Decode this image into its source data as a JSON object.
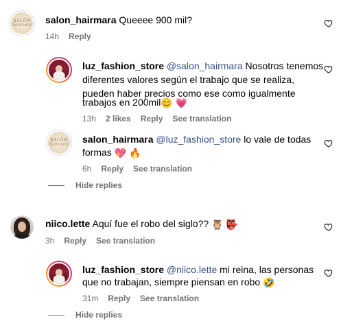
{
  "comments": [
    {
      "username": "salon_hairmara",
      "text": "Queeee 900 mil?",
      "time": "14h",
      "reply_label": "Reply",
      "avatar": "salon-hairmara-logo"
    }
  ],
  "replies_group_1": [
    {
      "username": "luz_fashion_store",
      "mention": "@salon_hairmara",
      "text_line1": " Nosotros tenemos",
      "text_line2": "diferentes valores según el trabajo que se realiza,",
      "text_line3": "pueden haber precios como ese como igualmente",
      "text_line4": "trabajos en 200mil",
      "emojis": [
        "😊",
        "💗"
      ],
      "time": "13h",
      "likes": "2 likes",
      "reply_label": "Reply",
      "translation_label": "See translation"
    },
    {
      "username": "salon_hairmara",
      "mention": "@luz_fashion_store",
      "text_line1": " lo vale de todas",
      "text_line2": "formas",
      "emojis": [
        "💖",
        "🔥"
      ],
      "time": "6h",
      "reply_label": "Reply",
      "translation_label": "See translation"
    }
  ],
  "hide_replies_1": "Hide replies",
  "comment_2": {
    "username": "niico.lette",
    "text": "Aquí fue el robo del siglo??",
    "emojis": [
      "🦉",
      "👺"
    ],
    "time": "3h",
    "reply_label": "Reply",
    "translation_label": "See translation"
  },
  "replies_group_2": [
    {
      "username": "luz_fashion_store",
      "mention": "@niico.lette",
      "text_line1": " mi reina, las personas",
      "text_line2": "que no trabajan, siempre piensan en robo",
      "emojis": [
        "🤣"
      ],
      "time": "31m",
      "reply_label": "Reply",
      "translation_label": "See translation"
    }
  ],
  "hide_replies_2": "Hide replies",
  "colors": {
    "text": "#000000",
    "secondary": "#737373",
    "mention": "#385185",
    "story_ring": [
      "#f9c440",
      "#f2773a",
      "#e1306c",
      "#c13584"
    ]
  }
}
